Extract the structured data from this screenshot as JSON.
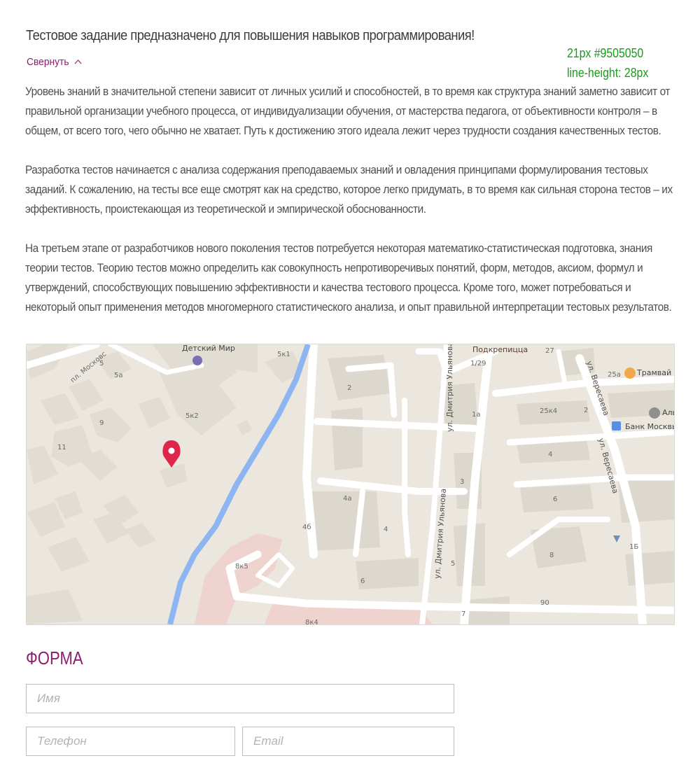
{
  "intro": {
    "title": "Тестовое задание предназначено для повышения навыков программирования!",
    "collapse_label": "Свернуть"
  },
  "annotation": {
    "line1": "21px #9505050",
    "line2": "line-height: 28px"
  },
  "article": {
    "paragraphs": [
      "Уровень знаний в значительной степени зависит от личных усилий и способностей, в то время как структура знаний заметно зависит от правильной организации учебного процесса, от индивидуализации обучения, от мастерства педагога, от объективности контроля – в общем, от всего того, чего обычно не хватает. Путь к достижению этого идеала лежит через трудности создания качественных тестов.",
      "Разработка тестов начинается с анализа содержания преподаваемых знаний и овладения принципами формулирования тестовых заданий. К сожалению, на тесты все еще смотрят как на средство, которое легко придумать, в то время как сильная сторона тестов – их эффективность, проистекающая из теоретической и эмпирической обоснованности.",
      "На третьем этапе от разработчиков нового поколения тестов потребуется некоторая математико-статистическая подготовка, знания теории тестов. Теорию тестов можно определить как совокупность непротиворечивых понятий, форм, методов, аксиом, формул и утверждений, способствующих повышению эффективности и качества тестового процесса. Кроме того, может потребоваться и некоторый опыт применения методов многомерного статистического анализа, и опыт правильной интерпретации тестовых результатов."
    ]
  },
  "map": {
    "labels": {
      "detsky_mir": "Детский Мир",
      "moskov_street": "пл. Московс",
      "podkrepitsa": "Подкрепицца",
      "tramvay": "Трамвай",
      "bank": "Банк Москвы",
      "alf": "Аль",
      "ulyanova_1": "ул. Дмитрия Ульянова",
      "ulyanova_2": "ул. Дмитрия Ульянова",
      "ulyanova_3": "ул. Дмитрия Ульянова",
      "veresaeva_1": "ул. Вересаева",
      "veresaeva_2": "ул. Вересаева",
      "h5": "5",
      "h5a": "5а",
      "h9": "9",
      "h11": "11",
      "h5k2": "5к2",
      "h5k1": "5к1",
      "h2": "2",
      "h1_29": "1/29",
      "h27": "27",
      "h25a": "25а",
      "h1a": "1а",
      "h25k4": "25к4",
      "h2b": "2",
      "h4": "4",
      "h3": "3",
      "h4a": "4а",
      "h4b": "4б",
      "h4c": "4",
      "h6": "6",
      "h1b": "1Б",
      "h8": "8",
      "h8k5": "8к5",
      "h6b": "6",
      "h5b": "5",
      "h90": "90",
      "h7": "7",
      "h8k4": "8к4"
    }
  },
  "form": {
    "title": "ФОРМА",
    "name_placeholder": "Имя",
    "phone_placeholder": "Телефон",
    "email_placeholder": "Email"
  },
  "colors": {
    "accent": "#8a1f6e",
    "annotation": "#1c9a1c",
    "text": "#505050",
    "map_pin": "#e0254b",
    "river": "#8cb5f2"
  }
}
